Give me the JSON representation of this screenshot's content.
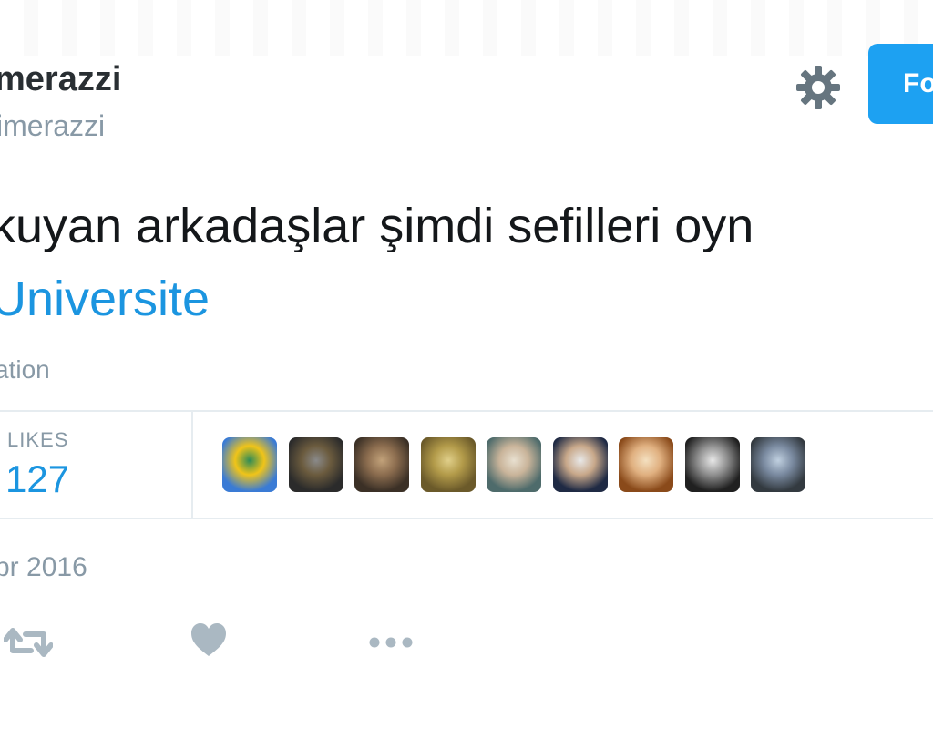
{
  "header": {
    "display_name": "merazzi",
    "handle": "imerazzi",
    "follow_label": "Fo",
    "settings_icon": "gear-icon"
  },
  "tweet": {
    "text": "kuyan arkadaşlar şimdi sefilleri oyn",
    "hashtag": "Universite",
    "translate_label": "ation",
    "timestamp": "pr 2016"
  },
  "stats": {
    "likes_label": "LIKES",
    "likes_count": "127"
  },
  "likers": [
    {
      "name": "liker-1",
      "palette": [
        "#3a7bd5",
        "#f0c419",
        "#2e8b57"
      ]
    },
    {
      "name": "liker-2",
      "palette": [
        "#2b2b2b",
        "#6b5b3e",
        "#8a8a8a"
      ]
    },
    {
      "name": "liker-3",
      "palette": [
        "#3b3026",
        "#8c6d4f",
        "#c2a27a"
      ]
    },
    {
      "name": "liker-4",
      "palette": [
        "#6b5a2a",
        "#b39b4a",
        "#e0cf8a"
      ]
    },
    {
      "name": "liker-5",
      "palette": [
        "#4e6b6b",
        "#c9b49a",
        "#e8e0d0"
      ]
    },
    {
      "name": "liker-6",
      "palette": [
        "#1f2a44",
        "#c8a88a",
        "#e8e8e8"
      ]
    },
    {
      "name": "liker-7",
      "palette": [
        "#8a4a1a",
        "#e0b080",
        "#f4e0c0"
      ]
    },
    {
      "name": "liker-8",
      "palette": [
        "#202020",
        "#909090",
        "#e8e8e8"
      ]
    },
    {
      "name": "liker-9",
      "palette": [
        "#333a40",
        "#7a8aa0",
        "#c0d0e0"
      ]
    }
  ],
  "actions": [
    {
      "name": "retweet-icon"
    },
    {
      "name": "like-icon"
    },
    {
      "name": "more-icon"
    }
  ],
  "colors": {
    "accent": "#1da1f2",
    "link": "#1b95e0",
    "muted": "#8899a6",
    "text": "#14171a"
  }
}
